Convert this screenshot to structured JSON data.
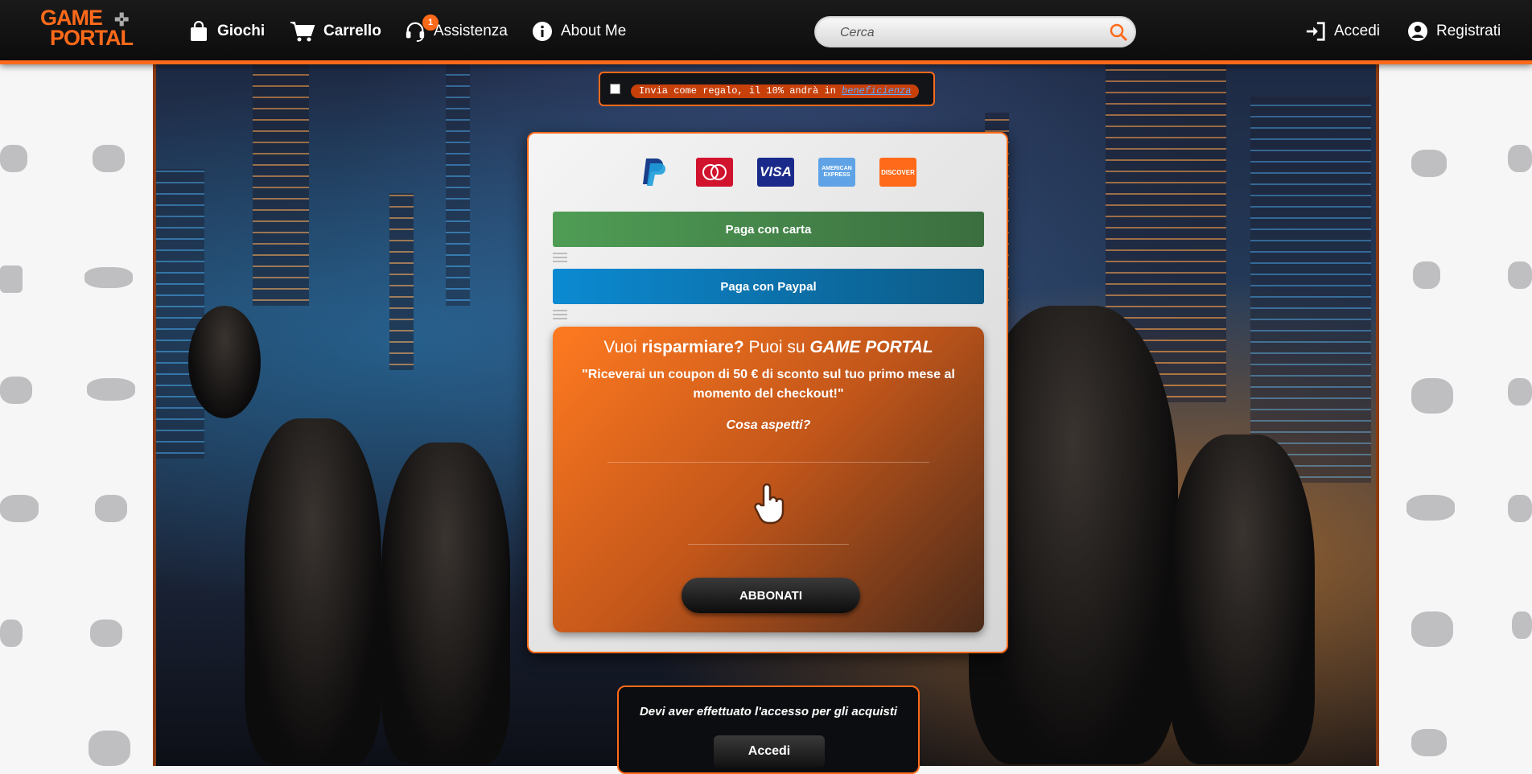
{
  "header": {
    "logo_line1": "GAME",
    "logo_line2": "PORTAL",
    "nav": [
      {
        "label": "Giochi",
        "icon": "shopping-bag-icon"
      },
      {
        "label": "Carrello",
        "icon": "cart-icon",
        "badge": "1"
      },
      {
        "label": "Assistenza",
        "icon": "headset-icon"
      },
      {
        "label": "About Me",
        "icon": "info-icon"
      }
    ],
    "search_placeholder": "Cerca",
    "login_label": "Accedi",
    "register_label": "Registrati"
  },
  "gift": {
    "text": "Invia come regalo, il 10% andrà in ",
    "link": "beneficienza"
  },
  "payment": {
    "card_brands": [
      "PayPal",
      "mastercard",
      "VISA",
      "AMERICAN EXPRESS",
      "DISCOVER"
    ],
    "pay_card_label": "Paga con carta",
    "pay_paypal_label": "Paga con Paypal"
  },
  "promo": {
    "title_pre": "Vuoi ",
    "title_bold": "risparmiare?",
    "title_mid": " Puoi su ",
    "title_brand": "GAME PORTAL",
    "quote": "\"Riceverai un coupon di 50 € di sconto sul tuo primo mese al momento del checkout!\"",
    "ask": "Cosa aspetti?",
    "subscribe_label": "ABBONATI"
  },
  "login_box": {
    "message": "Devi aver effettuato l'accesso per gli acquisti",
    "button_label": "Accedi"
  },
  "colors": {
    "accent": "#ff6a1a",
    "header_bg": "#111111",
    "green_button": "#4f9d55",
    "blue_button": "#0b8ad2"
  }
}
